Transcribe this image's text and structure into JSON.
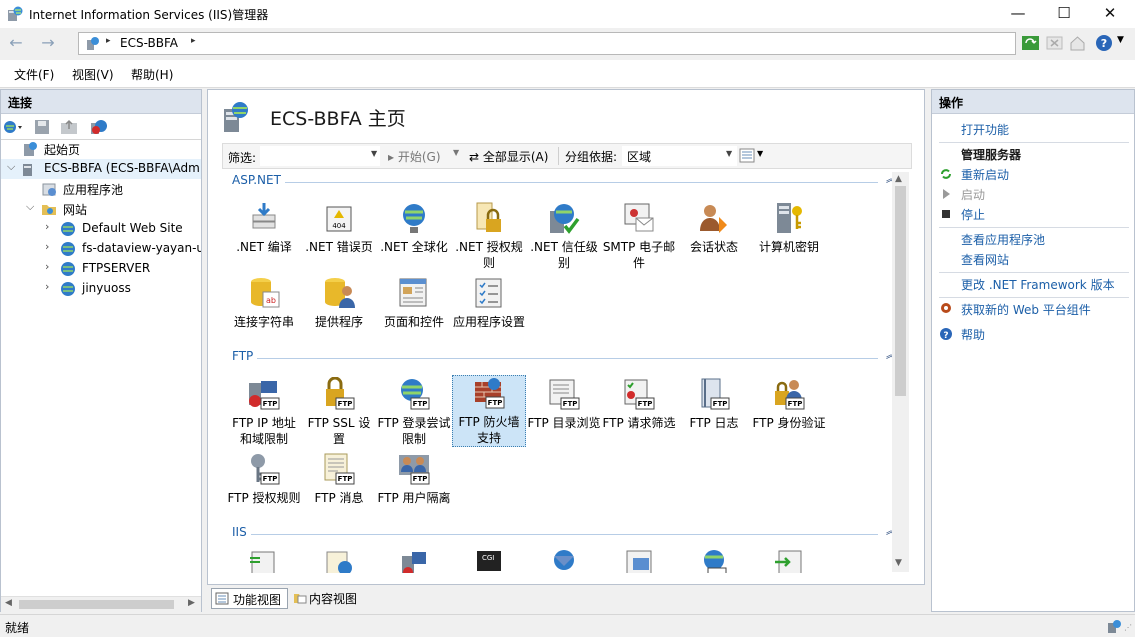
{
  "window": {
    "title": "Internet Information Services (IIS)管理器"
  },
  "address": {
    "crumb": "ECS-BBFA",
    "sep": "▸"
  },
  "menu": [
    "文件(F)",
    "视图(V)",
    "帮助(H)"
  ],
  "connections": {
    "header": "连接",
    "tree": [
      {
        "label": "起始页",
        "level": 0
      },
      {
        "label": "ECS-BBFA (ECS-BBFA\\Adm",
        "level": 0
      },
      {
        "label": "应用程序池",
        "level": 1
      },
      {
        "label": "网站",
        "level": 1
      },
      {
        "label": "Default Web Site",
        "level": 2
      },
      {
        "label": "fs-dataview-yayan-u",
        "level": 2
      },
      {
        "label": "FTPSERVER",
        "level": 2
      },
      {
        "label": "jinyuoss",
        "level": 2
      }
    ]
  },
  "center": {
    "title": "ECS-BBFA 主页",
    "filter_label": "筛选:",
    "start_label": "开始(G)",
    "showall_label": "全部显示(A)",
    "groupby_label": "分组依据:",
    "groupby_value": "区域",
    "sections": [
      {
        "name": "ASP.NET",
        "items": [
          ".NET 编译",
          ".NET 错误页",
          ".NET 全球化",
          ".NET 授权规则",
          ".NET 信任级别",
          "SMTP 电子邮件",
          "会话状态",
          "计算机密钥",
          "连接字符串",
          "提供程序",
          "页面和控件",
          "应用程序设置"
        ]
      },
      {
        "name": "FTP",
        "items": [
          "FTP IP 地址和域限制",
          "FTP SSL 设置",
          "FTP 登录尝试限制",
          "FTP 防火墙支持",
          "FTP 目录浏览",
          "FTP 请求筛选",
          "FTP 日志",
          "FTP 身份验证",
          "FTP 授权规则",
          "FTP 消息",
          "FTP 用户隔离"
        ]
      },
      {
        "name": "IIS"
      }
    ],
    "view_tabs": [
      "功能视图",
      "内容视图"
    ]
  },
  "actions": {
    "header": "操作",
    "open_feature": "打开功能",
    "manage_server_head": "管理服务器",
    "restart": "重新启动",
    "start": "启动",
    "stop": "停止",
    "view_pools": "查看应用程序池",
    "view_sites": "查看网站",
    "change_net": "更改 .NET Framework 版本",
    "get_components": "获取新的 Web 平台组件",
    "help": "帮助"
  },
  "status": {
    "text": "就绪"
  },
  "colors": {
    "link": "#1c5fa8",
    "pane_header": "#dde4ee",
    "selection": "#cce4f7"
  }
}
